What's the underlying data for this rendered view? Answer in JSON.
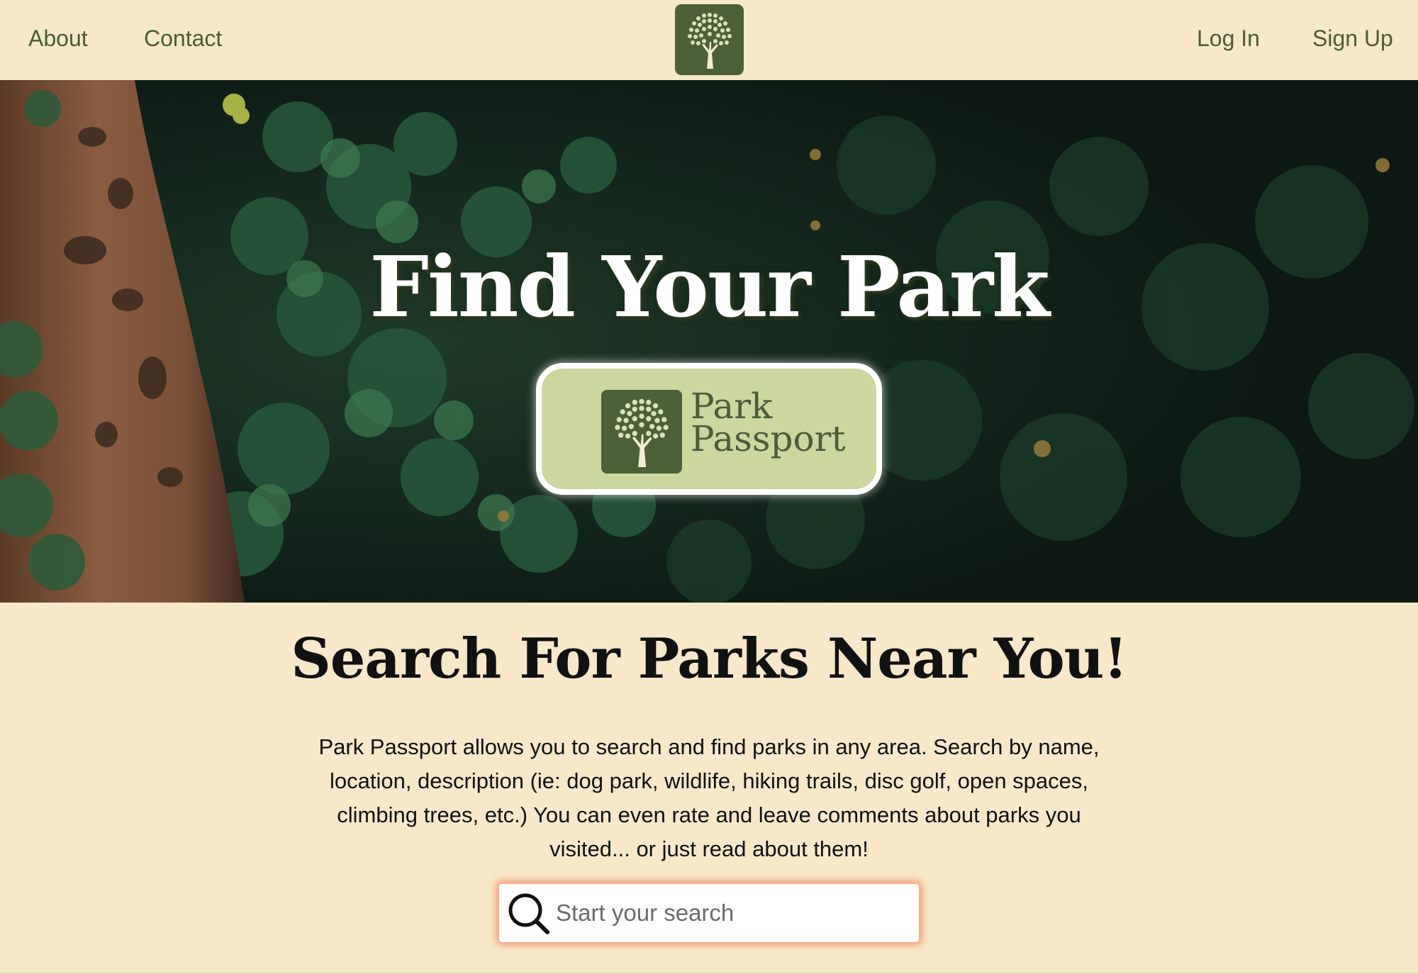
{
  "nav": {
    "about_label": "About",
    "contact_label": "Contact",
    "login_label": "Log In",
    "signup_label": "Sign Up",
    "logo_icon": "tree-icon"
  },
  "hero": {
    "title": "Find Your Park",
    "badge": {
      "icon": "tree-icon",
      "line1": "Park",
      "line2": "Passport"
    }
  },
  "content": {
    "heading": "Search For Parks Near You!",
    "description": "Park Passport allows you to search and find parks in any area. Search by name, location, description (ie: dog park, wildlife, hiking trails, disc golf, open spaces, climbing trees, etc.) You can even rate and leave comments about parks you visited... or just read about them!"
  },
  "search": {
    "icon": "search-icon",
    "placeholder": "Start your search",
    "value": ""
  },
  "colors": {
    "background": "#f7e8c9",
    "nav_text": "#4a5c35",
    "logo_green": "#4c6139",
    "badge_green": "#ccd79f",
    "search_glow": "#ec8a62"
  }
}
